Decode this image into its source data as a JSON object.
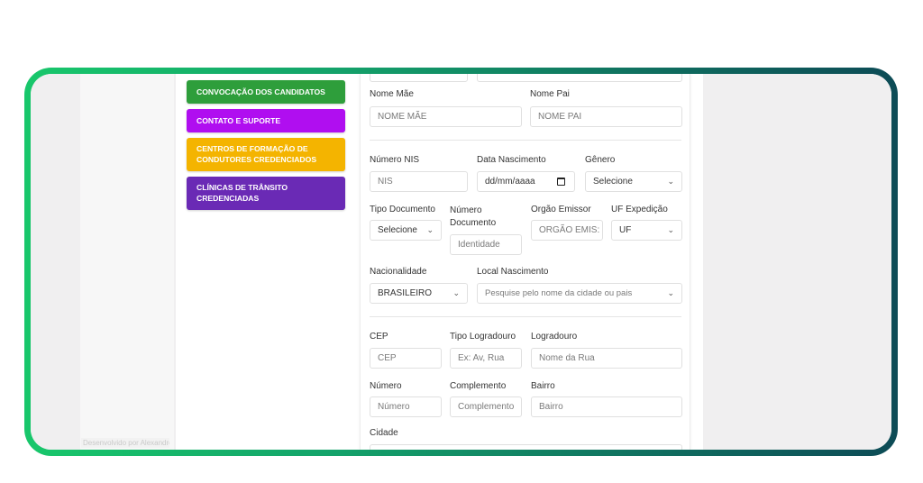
{
  "menu": [
    {
      "label": "CONVOCAÇÃO DOS CANDIDATOS",
      "color": "#2e9e3b"
    },
    {
      "label": "CONTATO E SUPORTE",
      "color": "#b00ef0"
    },
    {
      "label": "CENTROS DE FORMAÇÃO DE CONDUTORES CREDENCIADOS",
      "color": "#f4b400"
    },
    {
      "label": "CLÍNICAS DE TRÂNSITO CREDENCIADAS",
      "color": "#6a2ab5"
    }
  ],
  "form": {
    "nome_mae": {
      "label": "Nome Mãe",
      "placeholder": "NOME MÃE"
    },
    "nome_pai": {
      "label": "Nome Pai",
      "placeholder": "NOME PAI"
    },
    "nis": {
      "label": "Número NIS",
      "placeholder": "NIS"
    },
    "data_nascimento": {
      "label": "Data Nascimento",
      "placeholder": "dd/mm/aaaa"
    },
    "genero": {
      "label": "Gênero",
      "value": "Selecione"
    },
    "tipo_documento": {
      "label": "Tipo Documento",
      "value": "Selecione"
    },
    "numero_documento": {
      "label": "Número Documento",
      "placeholder": "Identidade"
    },
    "orgao_emissor": {
      "label": "Orgão Emissor",
      "placeholder": "ORGÃO EMIS:"
    },
    "uf_expedicao": {
      "label": "UF Expedição",
      "value": "UF"
    },
    "nacionalidade": {
      "label": "Nacionalidade",
      "value": "BRASILEIRO"
    },
    "local_nascimento": {
      "label": "Local Nascimento",
      "placeholder": "Pesquise pelo nome da cidade ou pais"
    },
    "cep": {
      "label": "CEP",
      "placeholder": "CEP"
    },
    "tipo_logradouro": {
      "label": "Tipo Logradouro",
      "placeholder": "Ex: Av, Rua"
    },
    "logradouro": {
      "label": "Logradouro",
      "placeholder": "Nome da Rua"
    },
    "numero": {
      "label": "Número",
      "placeholder": "Número"
    },
    "complemento": {
      "label": "Complemento",
      "placeholder": "Complemento"
    },
    "bairro": {
      "label": "Bairro",
      "placeholder": "Bairro"
    },
    "cidade": {
      "label": "Cidade"
    }
  },
  "footer": {
    "text": "Desenvolvido por AlexandreSilveira"
  },
  "icons": {
    "chevron": "chevron-down-icon",
    "calendar": "calendar-icon"
  }
}
